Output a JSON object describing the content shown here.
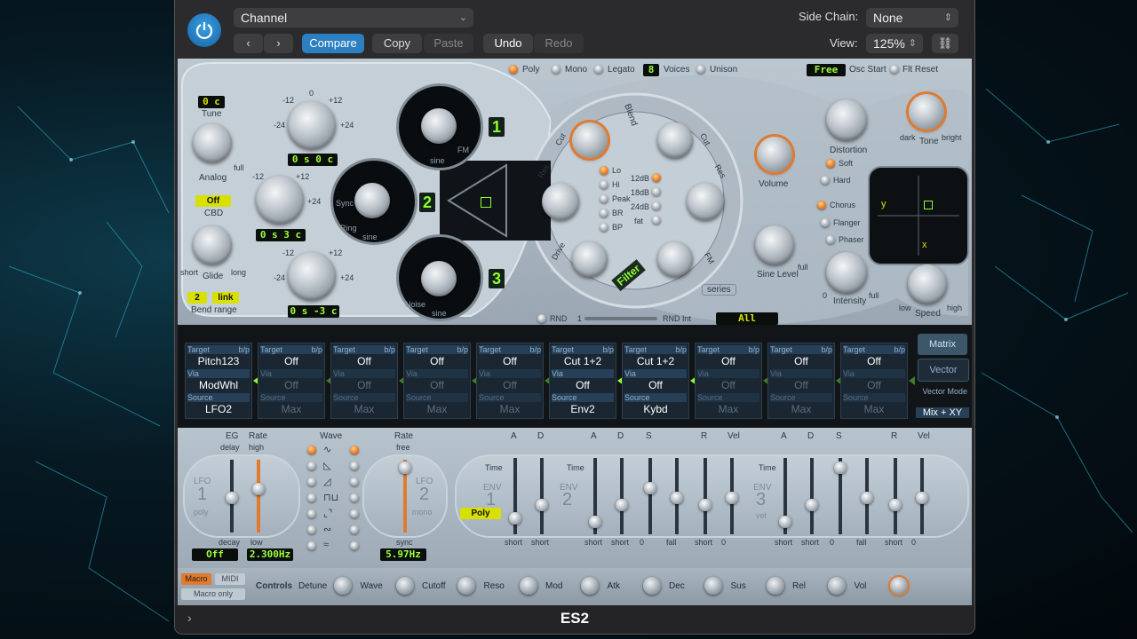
{
  "header": {
    "preset": "Channel",
    "compare": "Compare",
    "copy": "Copy",
    "paste": "Paste",
    "undo": "Undo",
    "redo": "Redo",
    "sidechain_label": "Side Chain:",
    "sidechain_value": "None",
    "view_label": "View:",
    "view_value": "125%"
  },
  "voice": {
    "poly": "Poly",
    "mono": "Mono",
    "legato": "Legato",
    "voices_count": "8",
    "voices": "Voices",
    "unison": "Unison",
    "osc_start_value": "Free",
    "osc_start": "Osc Start",
    "flt_reset": "Flt Reset"
  },
  "left": {
    "tune_value": "0 c",
    "tune": "Tune",
    "analog": "Analog",
    "full": "full",
    "cbd_value": "Off",
    "cbd": "CBD",
    "glide": "Glide",
    "short": "short",
    "long": "long",
    "bend_value": "2",
    "bend_link": "link",
    "bend": "Bend range"
  },
  "osc": {
    "o1_readout": "0 s   0 c",
    "o2_readout": "0 s   3 c",
    "o3_readout": "0 s   -3 c",
    "n1": "1",
    "n2": "2",
    "n3": "3",
    "m12": "-12",
    "p12": "+12",
    "m24": "-24",
    "p24": "+24",
    "zero": "0",
    "sine": "sine",
    "fm": "FM",
    "ring": "Ring",
    "sync": "Sync",
    "noise": "Noise"
  },
  "filter": {
    "blend": "Blend",
    "cut": "Cut",
    "res": "Res",
    "drive": "Drive",
    "fm": "FM",
    "lo": "Lo",
    "hi": "Hi",
    "peak": "Peak",
    "br": "BR",
    "bp": "BP",
    "db12": "12dB",
    "db18": "18dB",
    "db24": "24dB",
    "fat": "fat",
    "filter_label": "Filter",
    "series": "series"
  },
  "right": {
    "distortion": "Distortion",
    "soft": "Soft",
    "hard": "Hard",
    "tone": "Tone",
    "dark": "dark",
    "bright": "bright",
    "volume": "Volume",
    "chorus": "Chorus",
    "flanger": "Flanger",
    "phaser": "Phaser",
    "sine_level": "Sine Level",
    "intensity": "Intensity",
    "speed": "Speed",
    "low": "low",
    "high": "high",
    "x": "x",
    "y": "y",
    "full": "full",
    "zero": "0"
  },
  "rnd": {
    "rnd": "RND",
    "one": "1",
    "rnd_int": "RND Int",
    "all": "All"
  },
  "matrix": {
    "target": "Target",
    "via": "Via",
    "source": "Source",
    "bp": "b/p",
    "slots": [
      {
        "target": "Pitch123",
        "via": "ModWhl",
        "source": "LFO2",
        "active": true
      },
      {
        "target": "Off",
        "via": "Off",
        "source": "Max",
        "active": false
      },
      {
        "target": "Off",
        "via": "Off",
        "source": "Max",
        "active": false
      },
      {
        "target": "Off",
        "via": "Off",
        "source": "Max",
        "active": false
      },
      {
        "target": "Off",
        "via": "Off",
        "source": "Max",
        "active": false
      },
      {
        "target": "Cut 1+2",
        "via": "Off",
        "source": "Env2",
        "active": true
      },
      {
        "target": "Cut 1+2",
        "via": "Off",
        "source": "Kybd",
        "active": true
      },
      {
        "target": "Off",
        "via": "Off",
        "source": "Max",
        "active": false
      },
      {
        "target": "Off",
        "via": "Off",
        "source": "Max",
        "active": false
      },
      {
        "target": "Off",
        "via": "Off",
        "source": "Max",
        "active": false
      }
    ],
    "matrix_btn": "Matrix",
    "vector_btn": "Vector",
    "vector_mode": "Vector Mode",
    "vector_mode_value": "Mix + XY"
  },
  "lfo": {
    "eg": "EG",
    "delay": "delay",
    "decay": "decay",
    "rate": "Rate",
    "high": "high",
    "low": "low",
    "lfo1": "LFO",
    "lfo1_num": "1",
    "poly": "poly",
    "off": "Off",
    "rate1": "2.300Hz",
    "wave": "Wave",
    "free": "free",
    "lfo2": "LFO",
    "lfo2_num": "2",
    "mono": "mono",
    "sync": "sync",
    "rate2": "5.97Hz"
  },
  "env": {
    "a": "A",
    "d": "D",
    "s": "S",
    "r": "R",
    "vel": "Vel",
    "time": "Time",
    "long": "long",
    "short": "short",
    "full": "full",
    "rise": "rise",
    "fall": "fall",
    "env1": "ENV",
    "n1": "1",
    "env2": "ENV",
    "n2": "2",
    "env3": "ENV",
    "n3": "3",
    "poly_value": "Poly",
    "vel_label": "vel"
  },
  "macro": {
    "macro": "Macro",
    "midi": "MIDI",
    "macro_only": "Macro only",
    "controls": "Controls",
    "items": [
      "Detune",
      "Wave",
      "Cutoff",
      "Reso",
      "Mod",
      "Atk",
      "Dec",
      "Sus",
      "Rel",
      "Vol"
    ]
  },
  "footer": {
    "title": "ES2"
  }
}
